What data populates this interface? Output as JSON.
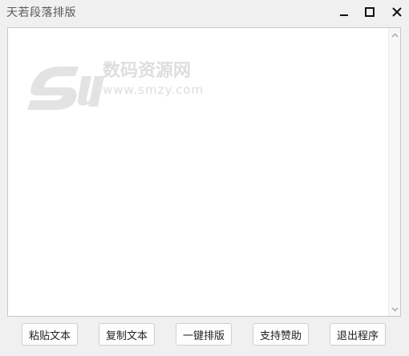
{
  "window": {
    "title": "天若段落排版"
  },
  "titlebar_icons": {
    "minimize": "minimize-icon",
    "maximize": "maximize-icon",
    "close": "close-icon"
  },
  "editor": {
    "value": "",
    "scroll_up_icon": "chevron-up-icon",
    "scroll_down_icon": "chevron-down-icon"
  },
  "watermark": {
    "brand": "数码资源网",
    "url": "www.smzy.com"
  },
  "buttons": {
    "paste": "粘贴文本",
    "copy": "复制文本",
    "format": "一键排版",
    "support": "支持赞助",
    "exit": "退出程序"
  },
  "colors": {
    "window_bg": "#f0f0f0",
    "editor_bg": "#ffffff",
    "border": "#c8c8c8",
    "watermark": "#dcdcdc"
  }
}
